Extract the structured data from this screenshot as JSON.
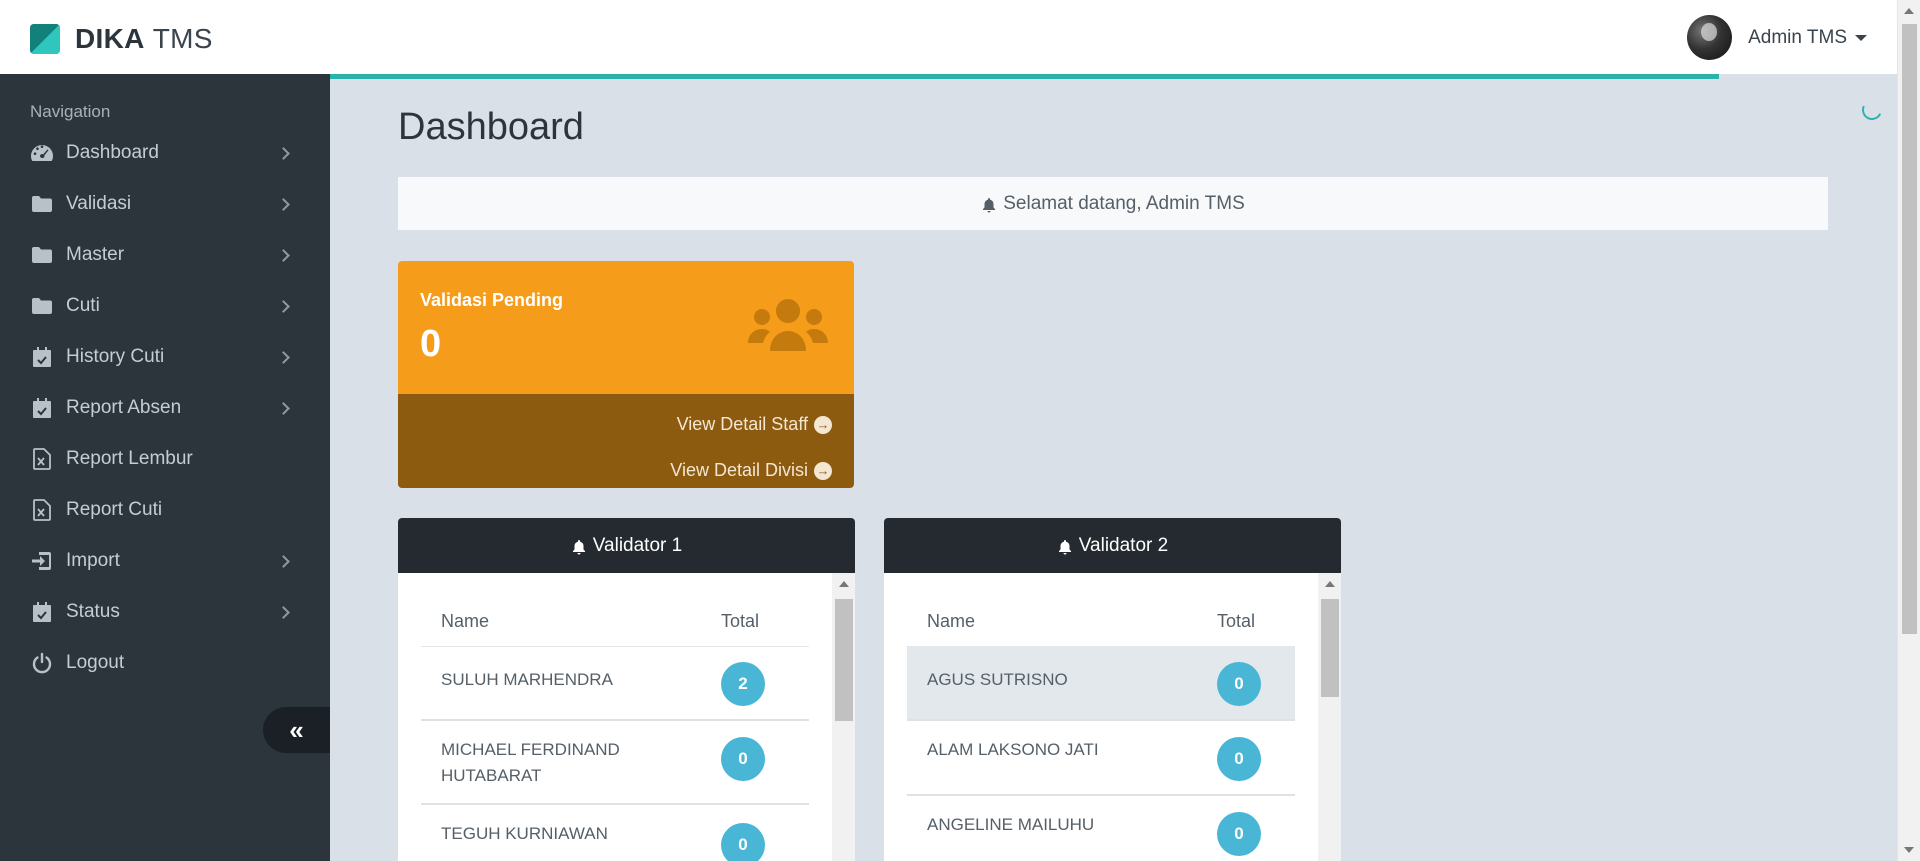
{
  "app": {
    "brand_bold": "DIKA",
    "brand_light": "TMS"
  },
  "header": {
    "user_name": "Admin TMS"
  },
  "sidebar": {
    "header": "Navigation",
    "items": [
      {
        "label": "Dashboard",
        "icon": "dashboard-gauge-icon",
        "has_children": true
      },
      {
        "label": "Validasi",
        "icon": "folder-icon",
        "has_children": true
      },
      {
        "label": "Master",
        "icon": "folder-icon",
        "has_children": true
      },
      {
        "label": "Cuti",
        "icon": "folder-icon",
        "has_children": true
      },
      {
        "label": "History Cuti",
        "icon": "calendar-check-icon",
        "has_children": true
      },
      {
        "label": "Report Absen",
        "icon": "calendar-check-icon",
        "has_children": true
      },
      {
        "label": "Report Lembur",
        "icon": "file-excel-icon",
        "has_children": false
      },
      {
        "label": "Report Cuti",
        "icon": "file-excel-icon",
        "has_children": false
      },
      {
        "label": "Import",
        "icon": "sign-in-icon",
        "has_children": true
      },
      {
        "label": "Status",
        "icon": "calendar-check-icon",
        "has_children": true
      },
      {
        "label": "Logout",
        "icon": "power-icon",
        "has_children": false
      }
    ],
    "collapse_icon": "double-chevron-left-icon"
  },
  "main": {
    "title": "Dashboard",
    "alert": "Selamat datang, Admin TMS",
    "stat": {
      "title": "Validasi Pending",
      "value": "0",
      "link_staff": "View Detail Staff",
      "link_divisi": "View Detail Divisi",
      "color": "#f59c1a"
    },
    "validators": [
      {
        "title": "Validator 1",
        "columns": [
          "Name",
          "Total"
        ],
        "rows": [
          {
            "name": "SULUH MARHENDRA",
            "total": "2"
          },
          {
            "name": "MICHAEL FERDINAND HUTABARAT",
            "total": "0"
          },
          {
            "name": "TEGUH KURNIAWAN",
            "total": "0"
          }
        ]
      },
      {
        "title": "Validator 2",
        "columns": [
          "Name",
          "Total"
        ],
        "rows": [
          {
            "name": "AGUS SUTRISNO",
            "total": "0"
          },
          {
            "name": "ALAM LAKSONO JATI",
            "total": "0"
          },
          {
            "name": "ANGELINE MAILUHU",
            "total": "0"
          }
        ]
      }
    ]
  },
  "colors": {
    "accent": "#2bb3ab",
    "sidebar": "#2d353c",
    "badge": "#49b6d6"
  }
}
